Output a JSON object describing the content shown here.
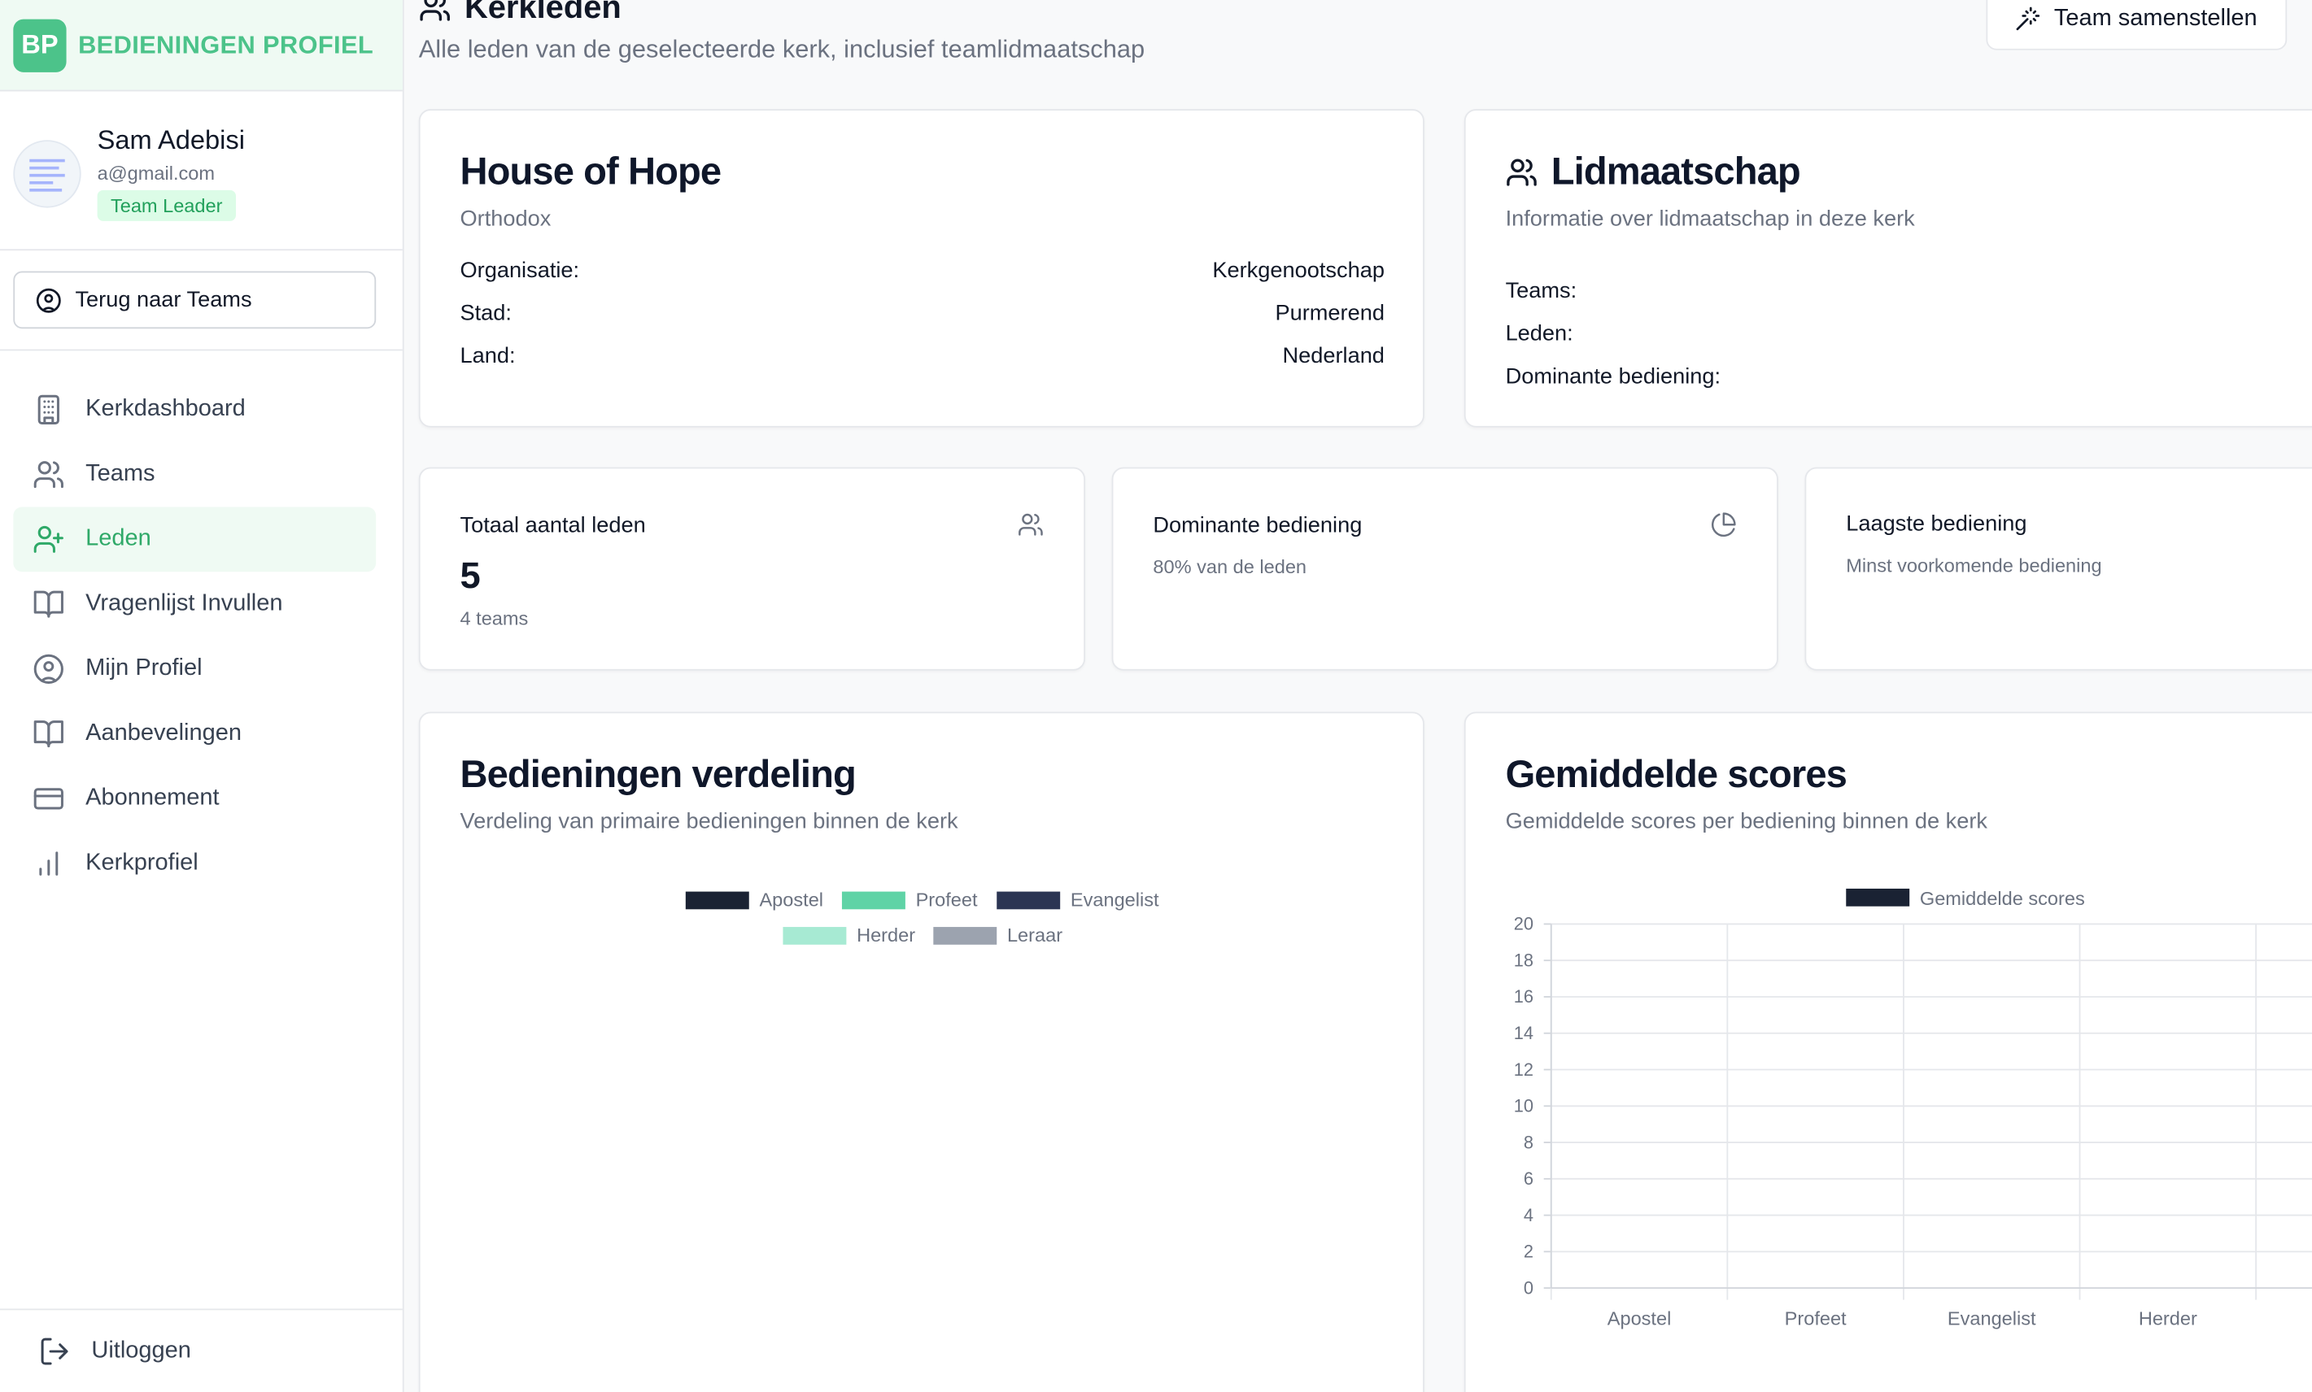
{
  "brand": {
    "badge": "BP",
    "name": "BEDIENINGEN PROFIEL"
  },
  "user": {
    "name": "Sam Adebisi",
    "email": "a@gmail.com",
    "role": "Team Leader"
  },
  "back_button": "Terug naar Teams",
  "nav": [
    {
      "label": "Kerkdashboard",
      "icon": "building-icon",
      "active": false
    },
    {
      "label": "Teams",
      "icon": "users-icon",
      "active": false
    },
    {
      "label": "Leden",
      "icon": "user-plus-icon",
      "active": true
    },
    {
      "label": "Vragenlijst Invullen",
      "icon": "book-open-icon",
      "active": false
    },
    {
      "label": "Mijn Profiel",
      "icon": "user-circle-icon",
      "active": false
    },
    {
      "label": "Aanbevelingen",
      "icon": "book-open-icon",
      "active": false
    },
    {
      "label": "Abonnement",
      "icon": "credit-card-icon",
      "active": false
    },
    {
      "label": "Kerkprofiel",
      "icon": "bar-chart-icon",
      "active": false
    }
  ],
  "logout": "Uitloggen",
  "header": {
    "title": "Kerkleden",
    "subtitle": "Alle leden van de geselecteerde kerk, inclusief teamlidmaatschap",
    "team_button": "Team samenstellen"
  },
  "church": {
    "name": "House of Hope",
    "denomination": "Orthodox",
    "rows": [
      {
        "label": "Organisatie:",
        "value": "Kerkgenootschap"
      },
      {
        "label": "Stad:",
        "value": "Purmerend"
      },
      {
        "label": "Land:",
        "value": "Nederland"
      }
    ]
  },
  "membership": {
    "title": "Lidmaatschap",
    "subtitle": "Informatie over lidmaatschap in deze kerk",
    "rows": [
      {
        "label": "Teams:",
        "value": ""
      },
      {
        "label": "Leden:",
        "value": ""
      },
      {
        "label": "Dominante bediening:",
        "value": ""
      }
    ]
  },
  "stats": {
    "total": {
      "title": "Totaal aantal leden",
      "value": "5",
      "sub": "4 teams"
    },
    "dominant": {
      "title": "Dominante bediening",
      "sub": "80% van de leden"
    },
    "lowest": {
      "title": "Laagste bediening",
      "sub": "Minst voorkomende bediening"
    }
  },
  "distribution": {
    "title": "Bedieningen verdeling",
    "subtitle": "Verdeling van primaire bedieningen binnen de kerk",
    "legend": [
      {
        "label": "Apostel",
        "color": "#1a2233"
      },
      {
        "label": "Profeet",
        "color": "#5fd3a6"
      },
      {
        "label": "Evangelist",
        "color": "#2b3553"
      },
      {
        "label": "Herder",
        "color": "#a7ead3"
      },
      {
        "label": "Leraar",
        "color": "#9ca3af"
      }
    ]
  },
  "scores": {
    "title": "Gemiddelde scores",
    "subtitle": "Gemiddelde scores per bediening binnen de kerk"
  },
  "chart_data": {
    "type": "bar",
    "categories": [
      "Apostel",
      "Profeet",
      "Evangelist",
      "Herder"
    ],
    "series": [
      {
        "name": "Gemiddelde scores",
        "values": [
          0,
          0,
          0,
          0
        ],
        "color": "#1a2233"
      }
    ],
    "ylim": [
      0,
      20
    ],
    "yticks": [
      0,
      2,
      4,
      6,
      8,
      10,
      12,
      14,
      16,
      18,
      20
    ],
    "grid": true,
    "legend": "top"
  }
}
